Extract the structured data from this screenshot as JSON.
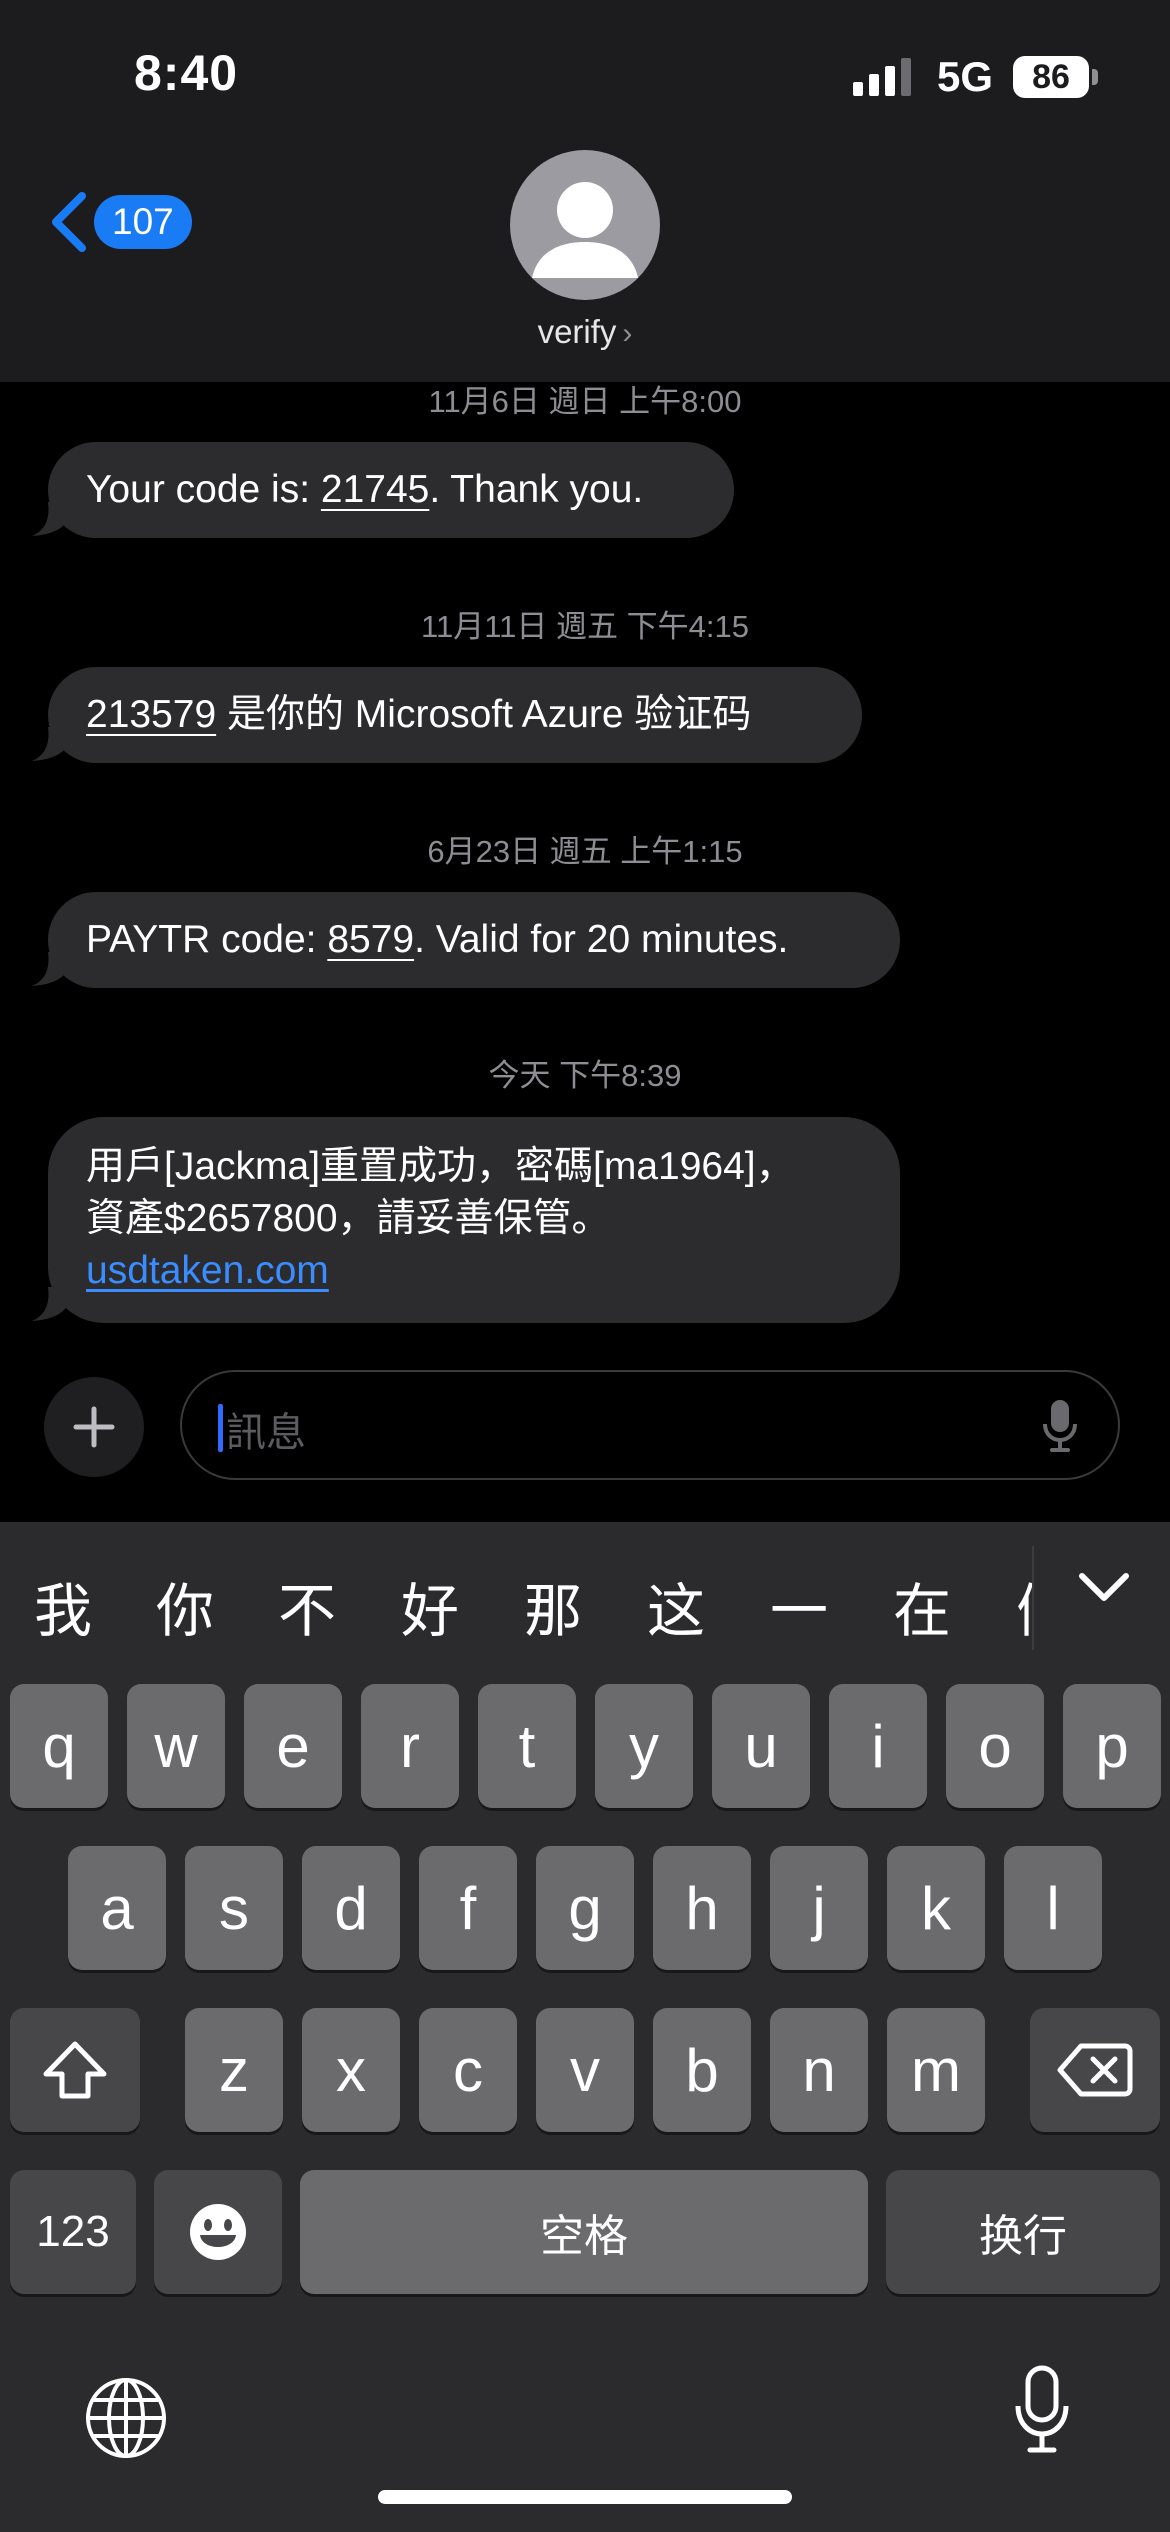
{
  "status": {
    "time": "8:40",
    "network": "5G",
    "battery": "86"
  },
  "nav": {
    "back_count": "107",
    "contact_name": "verify"
  },
  "messages": [
    {
      "date": "11月6日 週日 上午8:00",
      "code": "21745",
      "before": "Your code is: ",
      "after": ". Thank you."
    },
    {
      "date": "11月11日 週五 下午4:15",
      "code": "213579",
      "before": "",
      "after": " 是你的 Microsoft Azure 验证码"
    },
    {
      "date": "6月23日 週五 上午1:15",
      "code": "8579",
      "before": "PAYTR code: ",
      "after": ". Valid for 20 minutes."
    },
    {
      "date": "今天 下午8:39",
      "line1": "用戶[Jackma]重置成功，密碼[ma1964]，",
      "line2": "資產$2657800，請妥善保管。",
      "link": "usdtaken.com"
    }
  ],
  "composer": {
    "placeholder": "訊息"
  },
  "keyboard": {
    "candidates": [
      "我",
      "你",
      "不",
      "好",
      "那",
      "这",
      "一",
      "在",
      "们"
    ],
    "row1": [
      "q",
      "w",
      "e",
      "r",
      "t",
      "y",
      "u",
      "i",
      "o",
      "p"
    ],
    "row2": [
      "a",
      "s",
      "d",
      "f",
      "g",
      "h",
      "j",
      "k",
      "l"
    ],
    "row3": [
      "z",
      "x",
      "c",
      "v",
      "b",
      "n",
      "m"
    ],
    "numbers_label": "123",
    "space_label": "空格",
    "return_label": "换行"
  }
}
